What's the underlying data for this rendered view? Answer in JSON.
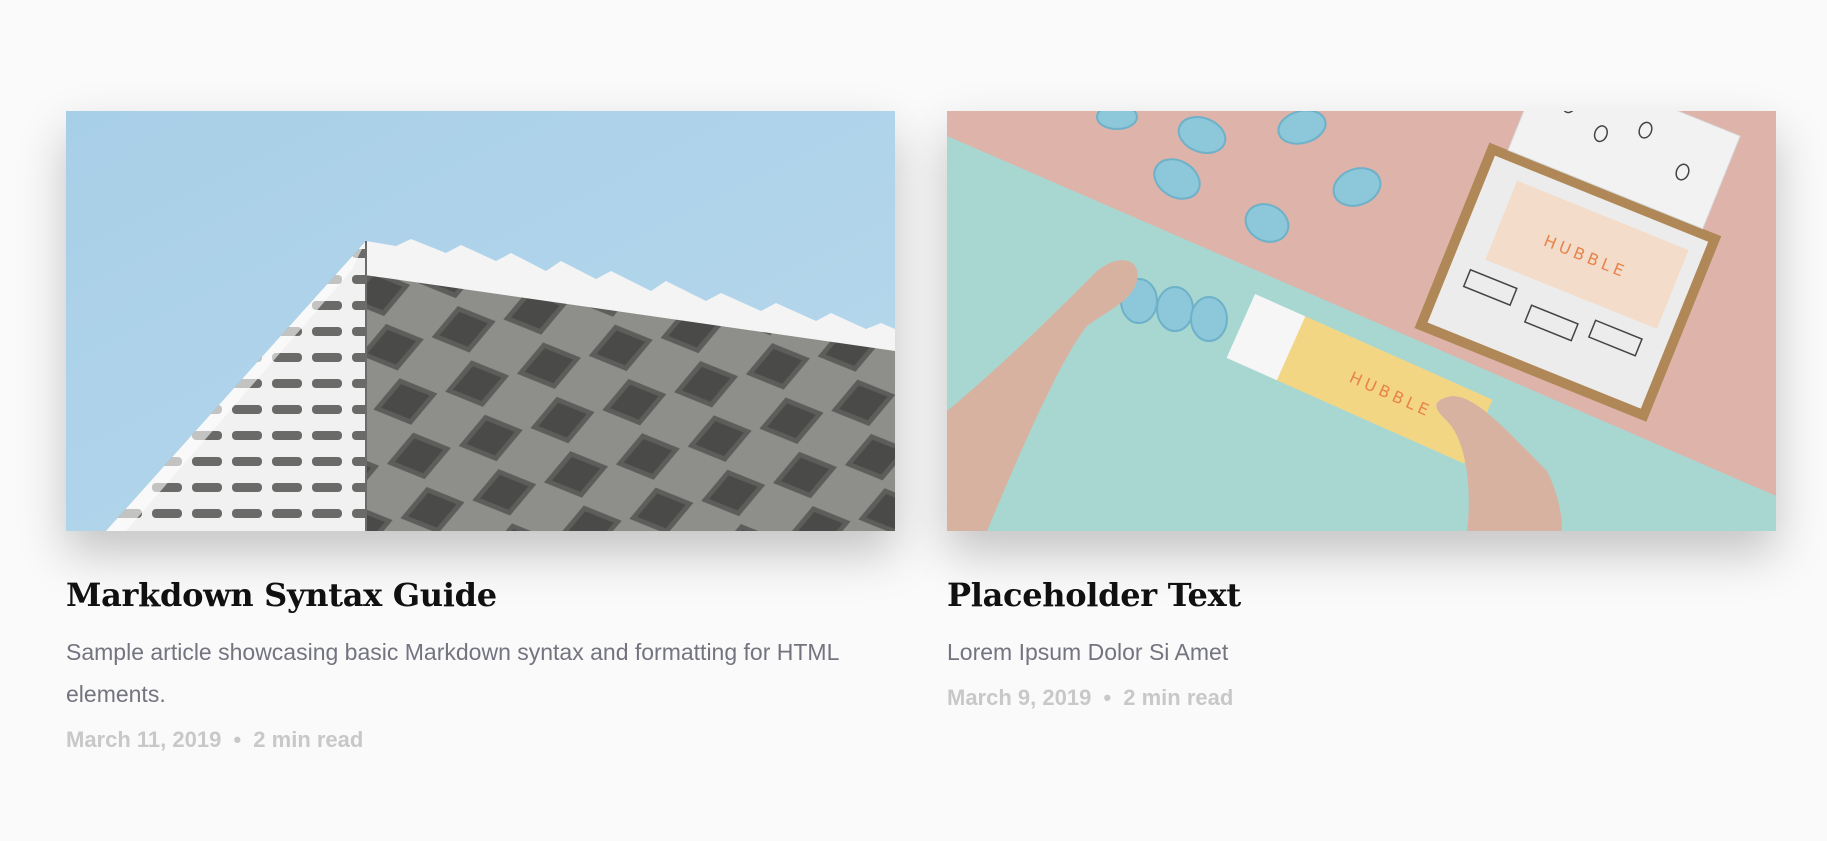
{
  "posts": [
    {
      "title": "Markdown Syntax Guide",
      "excerpt": "Sample article showcasing basic Markdown syntax and formatting for HTML elements.",
      "date": "March 11, 2019",
      "separator": "•",
      "read_time": "2 min read",
      "image_subject": "white-geometric-building-facade"
    },
    {
      "title": "Placeholder Text",
      "excerpt": "Lorem Ipsum Dolor Si Amet",
      "date": "March 9, 2019",
      "separator": "•",
      "read_time": "2 min read",
      "image_subject": "hubble-contact-lens-packaging",
      "image_text": "HUBBLE"
    }
  ],
  "colors": {
    "background": "#fafafa",
    "title": "#111111",
    "excerpt": "#737480",
    "meta": "#c8c8c8",
    "sky": "#a9cfe6",
    "pink": "#dfb3aa",
    "mint": "#a7d6d1",
    "yellow": "#f2d684",
    "orange": "#e8834a"
  }
}
